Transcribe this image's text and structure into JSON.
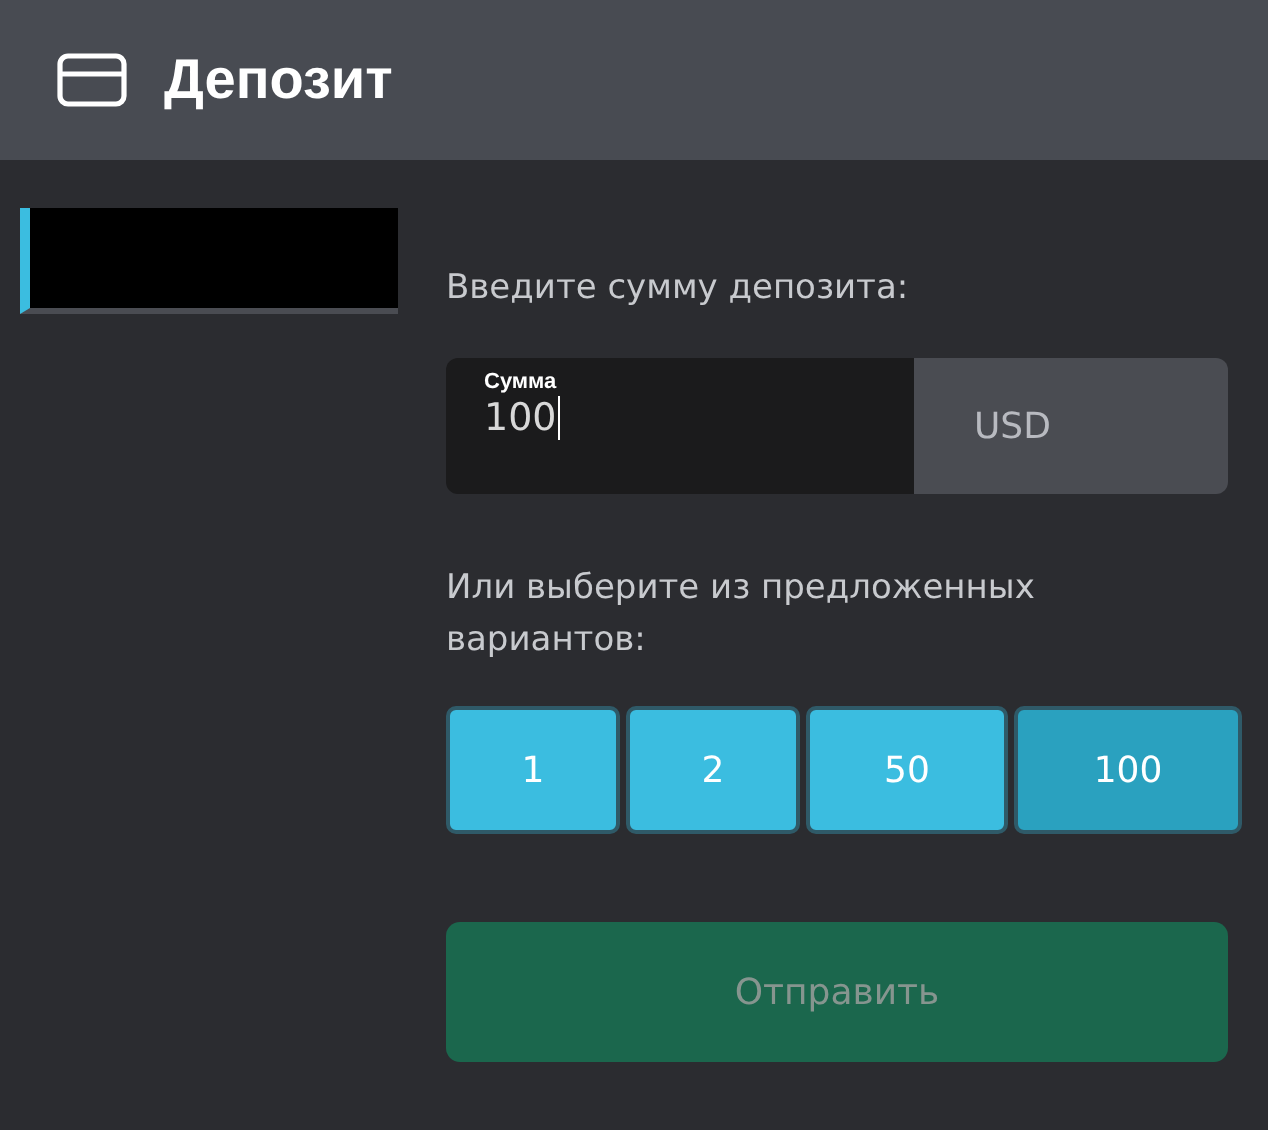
{
  "header": {
    "title": "Депозит"
  },
  "sidebar": {
    "items": [
      {
        "selected": true
      }
    ]
  },
  "form": {
    "prompt": "Введите сумму депозита:",
    "amount": {
      "label": "Сумма",
      "value": "100",
      "currency": "USD"
    },
    "presets_prompt": "Или выберите из предложенных вариантов:",
    "presets": [
      {
        "label": "1",
        "selected": false
      },
      {
        "label": "2",
        "selected": false
      },
      {
        "label": "50",
        "selected": false
      },
      {
        "label": "100",
        "selected": true
      }
    ],
    "submit": {
      "label": "Отправить",
      "disabled": true
    }
  }
}
